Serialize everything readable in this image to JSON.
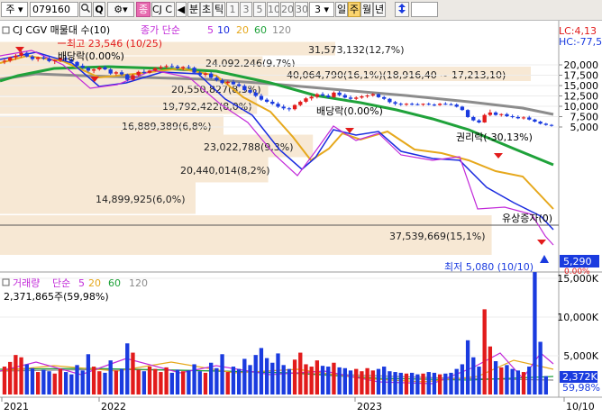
{
  "toolbar": {
    "market_label": "주",
    "stock_code": "079160",
    "search_icon": "search-icon",
    "q_label": "Q",
    "settings_icon": "settings-icon",
    "stock_name_badge": "종",
    "stock_name_short": "CJ C",
    "prev_icon": "triangle-left-icon",
    "periods": [
      "분",
      "초",
      "틱"
    ],
    "counts": [
      "1",
      "3",
      "5",
      "10",
      "20",
      "30"
    ],
    "count_value": "3",
    "units": [
      "일",
      "주",
      "월",
      "년"
    ],
    "active_unit": "주",
    "updown_icon": "up-down-arrows-icon"
  },
  "price_panel": {
    "series_title": "CJ CGV 매물대 수(10)",
    "ma_label": "종가 단순",
    "ma_periods": [
      "5",
      "10",
      "20",
      "60",
      "120"
    ],
    "lc_label": "LC:4,13",
    "hc_label": "HC:-77,5",
    "y_ticks": [
      "20,000",
      "17,500",
      "15,000",
      "12,500",
      "10,000",
      "7,500",
      "5,000"
    ],
    "current_price": "5,290",
    "price_pct": "0.00%",
    "high_label": "최고 23,546 (10/25)",
    "low_label": "최저 5,080 (10/10)",
    "events": [
      "배당락(0.00%)",
      "배당락(0.00%)",
      "권리락(-30,13%)",
      "유상증자(0)"
    ],
    "volume_profile": [
      "31,573,132(12,7%)",
      "24,092,246(9,7%)",
      "40,064,790(16,1%)(18,916,40 ~ 17,213,10)",
      "20,550,827(8,3%)",
      "19,792,422(8,0%)",
      "16,889,389(6,8%)",
      "23,022,788(9,3%)",
      "20,440,014(8,2%)",
      "14,899,925(6,0%)",
      "37,539,669(15,1%)"
    ]
  },
  "volume_panel": {
    "title": "거래량",
    "ma_label": "단순",
    "ma_periods": [
      "5",
      "20",
      "60",
      "120"
    ],
    "summary": "2,371,865주(59,98%)",
    "y_ticks": [
      "15,000K",
      "10,000K",
      "5,000K"
    ],
    "current_volume": "2,372K",
    "current_pct": "59,98%"
  },
  "x_axis": {
    "ticks": [
      "2021",
      "2022",
      "2023",
      "10/10"
    ]
  },
  "colors": {
    "up": "#e21b1b",
    "down": "#1a3bdf",
    "ma5": "#c22ad9",
    "ma10": "#1a2bdf",
    "ma20": "#e6a81c",
    "ma60": "#1fa23a",
    "ma120": "#8c8c8c",
    "profile": "#f7e8d4"
  }
}
